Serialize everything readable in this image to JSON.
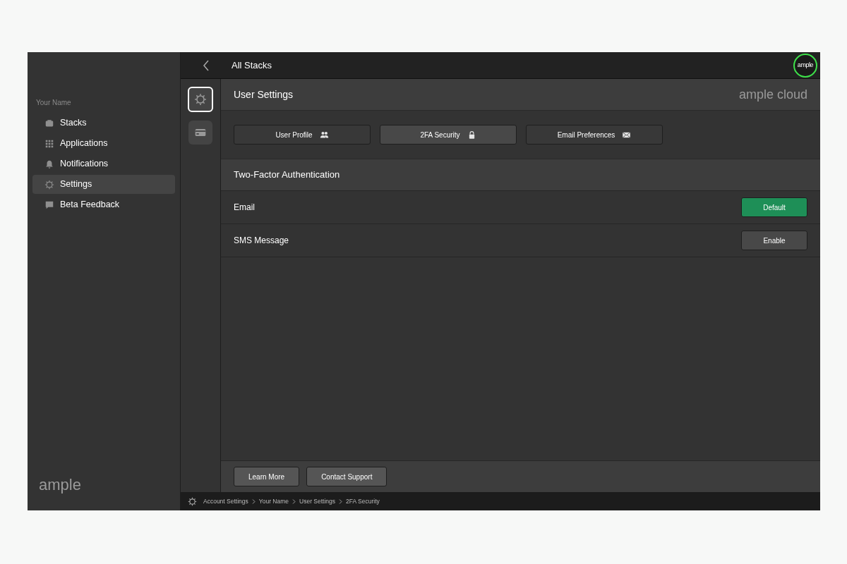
{
  "sidebar": {
    "user_name": "Your Name",
    "items": [
      {
        "label": "Stacks",
        "selected": false
      },
      {
        "label": "Applications",
        "selected": false
      },
      {
        "label": "Notifications",
        "selected": false
      },
      {
        "label": "Settings",
        "selected": true
      },
      {
        "label": "Beta Feedback",
        "selected": false
      }
    ],
    "logo": "ample"
  },
  "top_bar": {
    "title": "All Stacks",
    "avatar_text": "ample"
  },
  "rail": [
    {
      "selected": true
    },
    {
      "selected": false
    }
  ],
  "header": {
    "title": "User Settings",
    "brand": "ample cloud"
  },
  "tabs": [
    {
      "label": "User Profile",
      "selected": false
    },
    {
      "label": "2FA Security",
      "selected": true
    },
    {
      "label": "Email Preferences",
      "selected": false
    }
  ],
  "section": {
    "title": "Two-Factor Authentication",
    "methods": [
      {
        "label": "Email",
        "action": "Default",
        "default": true
      },
      {
        "label": "SMS Message",
        "action": "Enable",
        "default": false
      }
    ]
  },
  "footer_buttons": [
    "Learn More",
    "Contact Support"
  ],
  "breadcrumb": [
    "Account Settings",
    "Your Name",
    "User Settings",
    "2FA Security"
  ]
}
